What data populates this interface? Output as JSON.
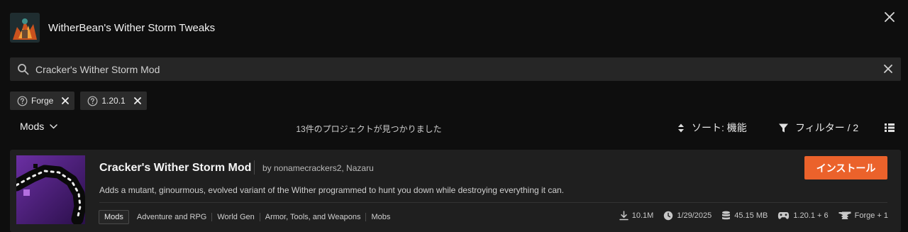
{
  "header": {
    "title": "WitherBean's Wither Storm Tweaks"
  },
  "search": {
    "value": "Cracker's Wither Storm Mod",
    "placeholder": ""
  },
  "filter_chips": [
    {
      "label": "Forge"
    },
    {
      "label": "1.20.1"
    }
  ],
  "toolbar": {
    "category": "Mods",
    "result_count": "13件のプロジェクトが見つかりました",
    "sort_label": "ソート: 機能",
    "filter_label": "フィルター / 2"
  },
  "results": [
    {
      "title": "Cracker's Wither Storm Mod",
      "authors": "by nonamecrackers2, Nazaru",
      "install_label": "インストール",
      "description": "Adds a mutant, ginourmous, evolved variant of the Wither programmed to hunt you down while destroying everything it can.",
      "primary_tag": "Mods",
      "tags": [
        "Adventure and RPG",
        "World Gen",
        "Armor, Tools, and Weapons",
        "Mobs"
      ],
      "downloads": "10.1M",
      "updated": "1/29/2025",
      "size": "45.15 MB",
      "game_versions": "1.20.1 + 6",
      "loaders": "Forge + 1"
    }
  ],
  "colors": {
    "background": "#0e0e0e",
    "surface": "#1f1f1f",
    "input": "#262626",
    "accent": "#eb622b"
  },
  "icons": [
    "close-icon",
    "search-icon",
    "help-icon",
    "chevron-down-icon",
    "sort-icon",
    "filter-icon",
    "list-view-icon",
    "download-icon",
    "clock-icon",
    "database-icon",
    "gamepad-icon",
    "anvil-icon"
  ]
}
